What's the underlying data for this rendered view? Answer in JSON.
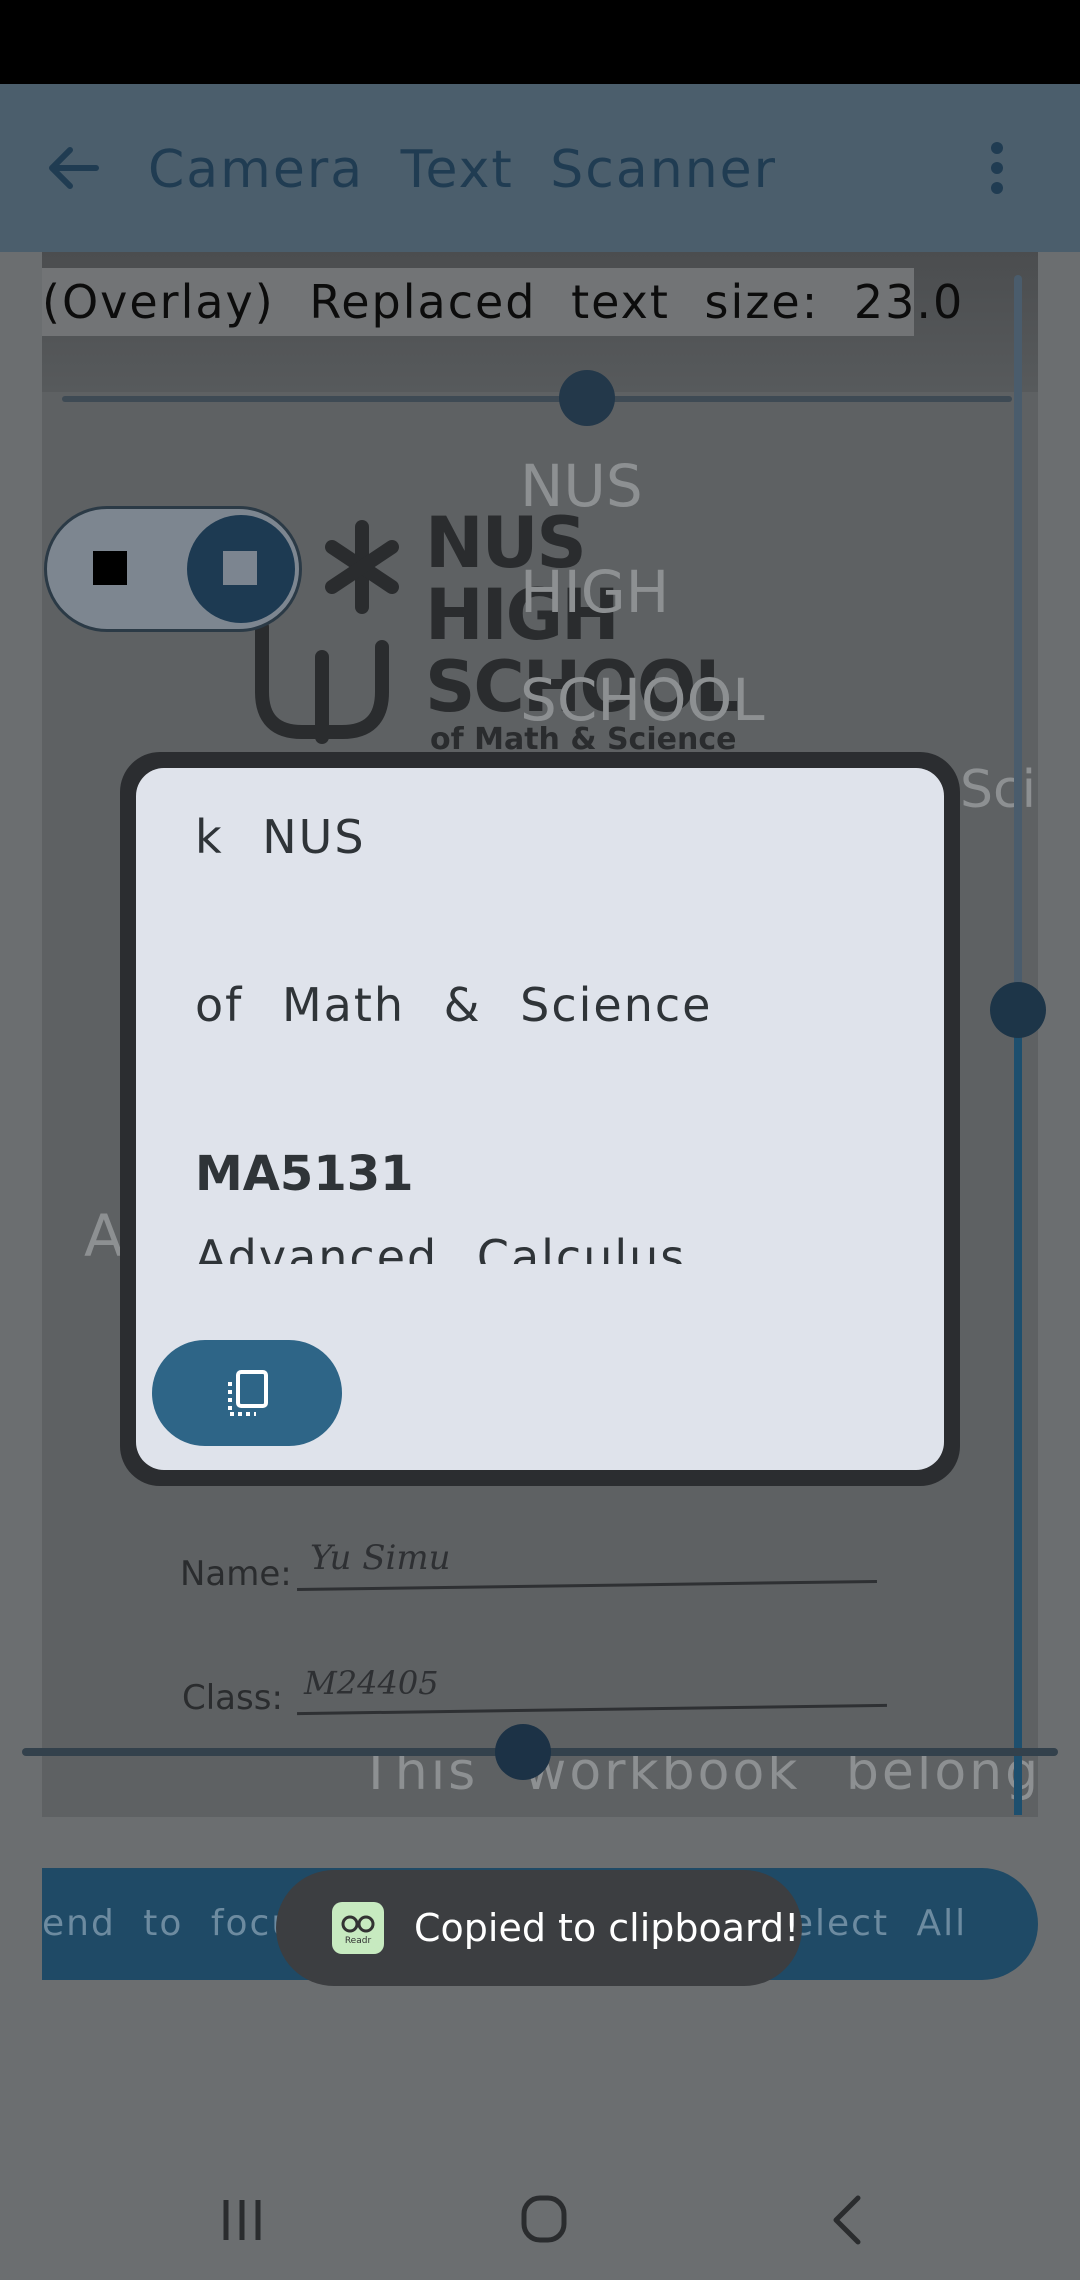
{
  "app_bar": {
    "title": "Camera Text Scanner",
    "back_icon": "arrow-back-icon",
    "more_icon": "more-vert-icon"
  },
  "overlay": {
    "size_label": "(Overlay) Replaced text size: 23.0",
    "ghost_lines": [
      "NUS",
      "HIGH",
      "SCHOOL",
      "Scie",
      "A",
      "This workbook belong"
    ]
  },
  "photo": {
    "school_lines": [
      "NUS",
      "HIGH",
      "SCHOOL",
      "of Math & Science"
    ],
    "name_label": "Name:",
    "name_value": "Yu Simu",
    "class_label": "Class:",
    "class_value": "M24405"
  },
  "dialog": {
    "lines": [
      "k NUS",
      "of Math & Science",
      "MA5131",
      "Advanced Calculus"
    ],
    "copy_icon": "copy-icon"
  },
  "bottom_button": {
    "left_text": "end to focus",
    "select_all": "Select All"
  },
  "toast": {
    "icon": "readr-app-icon",
    "icon_text": "Readr",
    "message": "Copied to clipboard!"
  },
  "nav": {
    "recents_icon": "recents-icon",
    "home_icon": "home-icon",
    "back_icon": "back-chevron-icon"
  },
  "colors": {
    "app_bar": "#4b5e6c",
    "accent": "#2e6587",
    "dialog_bg": "#dfe3eb",
    "toast_bg": "#3c3e41"
  }
}
